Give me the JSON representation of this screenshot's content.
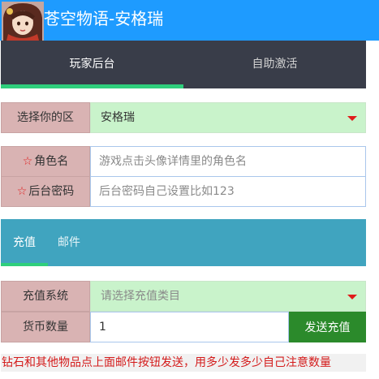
{
  "header": {
    "title": "苍空物语-安格瑞",
    "avatar": "avatar-image"
  },
  "main_tabs": [
    {
      "label": "玩家后台",
      "active": true
    },
    {
      "label": "自助激活",
      "active": false
    }
  ],
  "server": {
    "label": "选择你的区",
    "value": "安格瑞",
    "icon": "dropdown-caret-icon"
  },
  "character": {
    "label": "角色名",
    "placeholder": "游戏点击头像详情里的角色名",
    "required_mark": "☆"
  },
  "password": {
    "label": "后台密码",
    "placeholder": "后台密码自己设置比如123",
    "required_mark": "☆"
  },
  "sub_tabs": [
    {
      "label": "充值",
      "active": true
    },
    {
      "label": "邮件",
      "active": false
    }
  ],
  "recharge": {
    "label": "充值系统",
    "placeholder": "请选择充值类目",
    "icon": "dropdown-caret-icon"
  },
  "currency": {
    "label": "货币数量",
    "value": "1",
    "button": "发送充值"
  },
  "notice": "钻石和其他物品点上面邮件按钮发送，用多少发多少自己注意数量",
  "colors": {
    "header": "#1e9bff",
    "main_tabs_bg": "#393d49",
    "active_indicator": "#2fcf7c",
    "label_bg": "#d9b3b3",
    "select_bg": "#c9f3cb",
    "sub_tabs_bg": "#40a4bf",
    "send_button": "#2b8a2b",
    "notice_text": "#d41b1b"
  }
}
